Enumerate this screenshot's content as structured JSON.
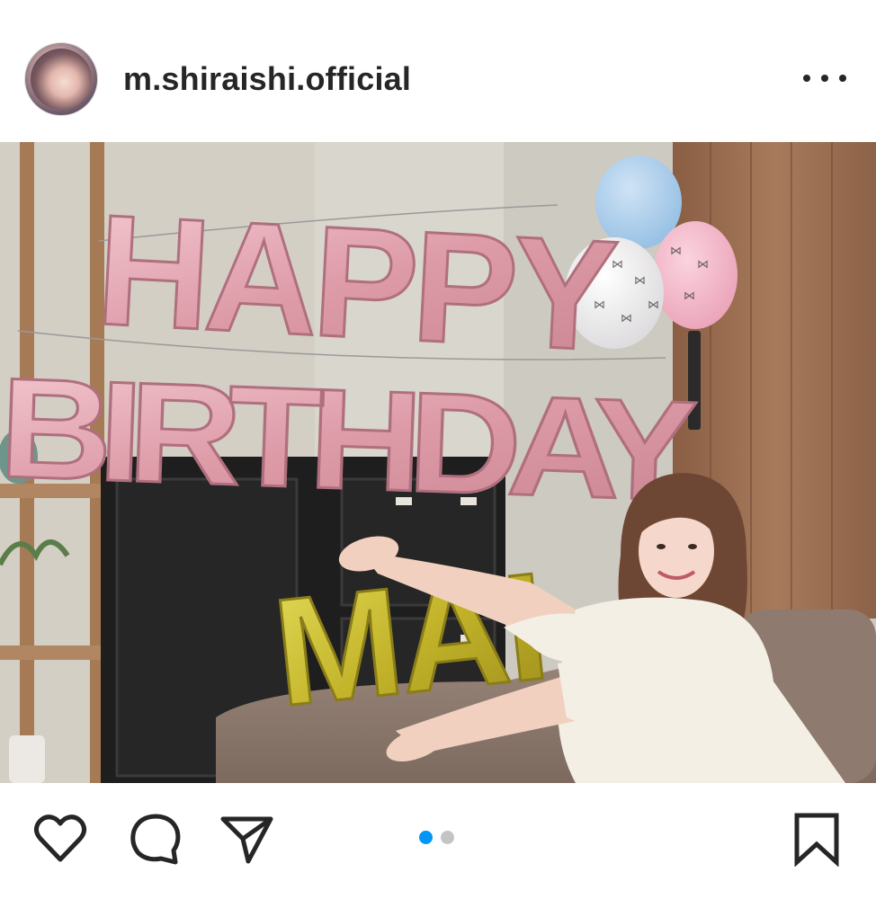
{
  "post": {
    "username": "m.shiraishi.official",
    "avatar_icon": "profile-avatar",
    "more_icon": "more-options-icon"
  },
  "photo": {
    "balloon_top_row": "HAPPY",
    "balloon_mid_row": "BIRTHDAY",
    "balloon_bottom_row": "MAI",
    "colors": {
      "rose_gold": "#e3a9b2",
      "gold": "#c9be2a",
      "blue_balloon": "#a9cdea",
      "white_balloon": "#f3f1f2",
      "pink_balloon": "#f1b9c9",
      "wood": "#9c6f52"
    }
  },
  "actions": {
    "like_icon": "heart-icon",
    "comment_icon": "comment-icon",
    "share_icon": "send-icon",
    "save_icon": "bookmark-icon"
  },
  "carousel": {
    "total": 2,
    "active": 1,
    "active_color": "#0095f6",
    "inactive_color": "#c4c4c4"
  }
}
